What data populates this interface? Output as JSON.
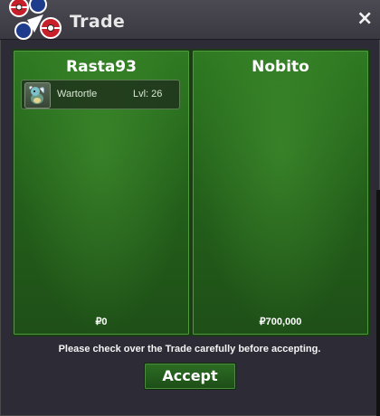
{
  "window": {
    "title": "Trade",
    "close_symbol": "×"
  },
  "left_panel": {
    "player": "Rasta93",
    "item": {
      "name": "Wartortle",
      "level": "Lvl: 26",
      "icon": "wartortle-icon"
    },
    "money": "₽0"
  },
  "right_panel": {
    "player": "Nobito",
    "money": "₽700,000"
  },
  "notice": "Please check over the Trade carefully before accepting.",
  "accept_label": "Accept",
  "colors": {
    "panel_green": "#2f7a22",
    "panel_border": "#1a3d14",
    "titlebar": "#4b4a52",
    "background": "#2c2b36"
  }
}
